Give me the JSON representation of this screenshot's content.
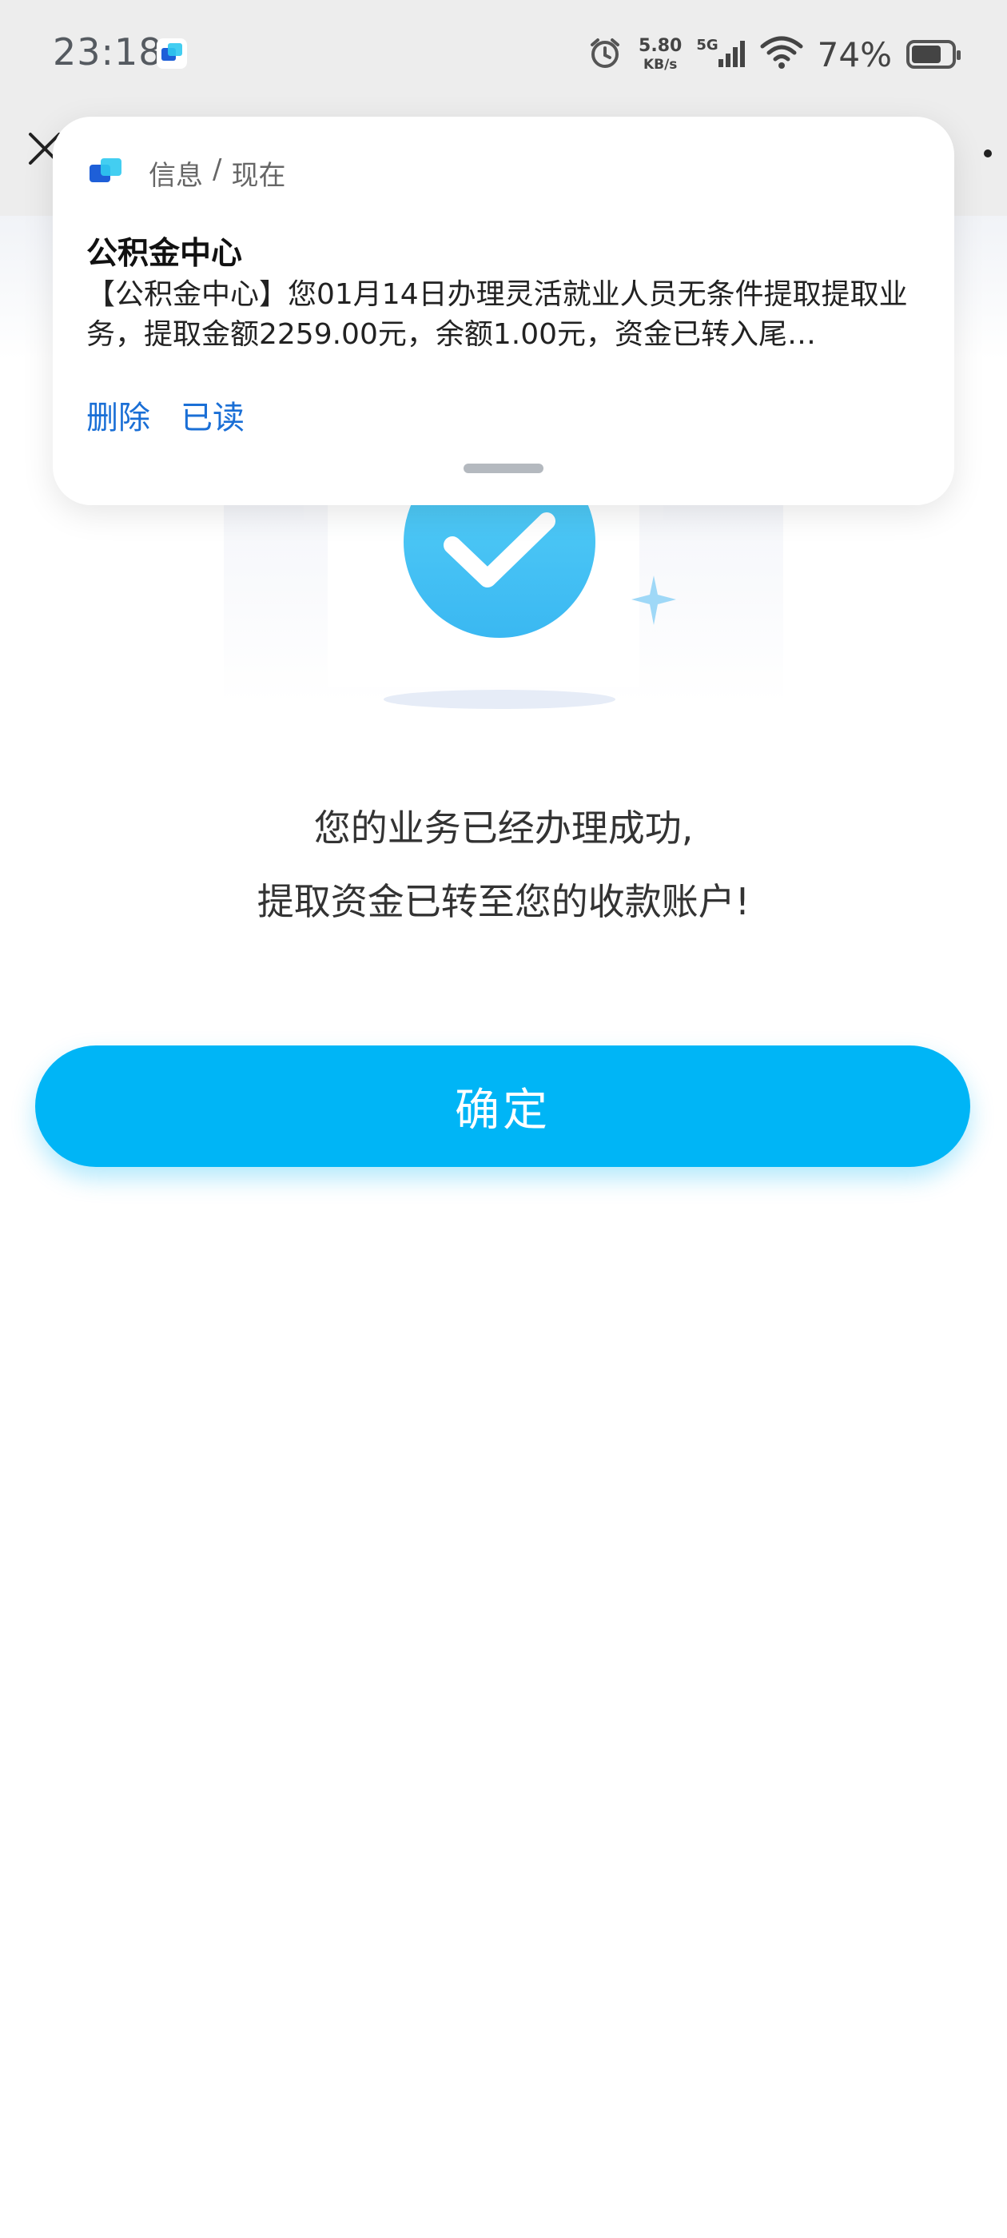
{
  "status_bar": {
    "time": "23:18",
    "speed_value": "5.80",
    "speed_unit": "KB/s",
    "network": "5G",
    "battery": "74%",
    "battery_level": 0.74
  },
  "notification": {
    "app": "信息",
    "separator": "/",
    "time": "现在",
    "title": "公积金中心",
    "body": "【公积金中心】您01月14日办理灵活就业人员无条件提取提取业务，提取金额2259.00元，余额1.00元，资金已转入尾…",
    "actions": [
      "删除",
      "已读"
    ]
  },
  "result": {
    "line1": "您的业务已经办理成功,",
    "line2": "提取资金已转至您的收款账户!"
  },
  "confirm_button": "确定",
  "colors": {
    "accent": "#00b5f6",
    "action_link": "#1a6fd6",
    "check_circle": "#4cc6f5"
  }
}
